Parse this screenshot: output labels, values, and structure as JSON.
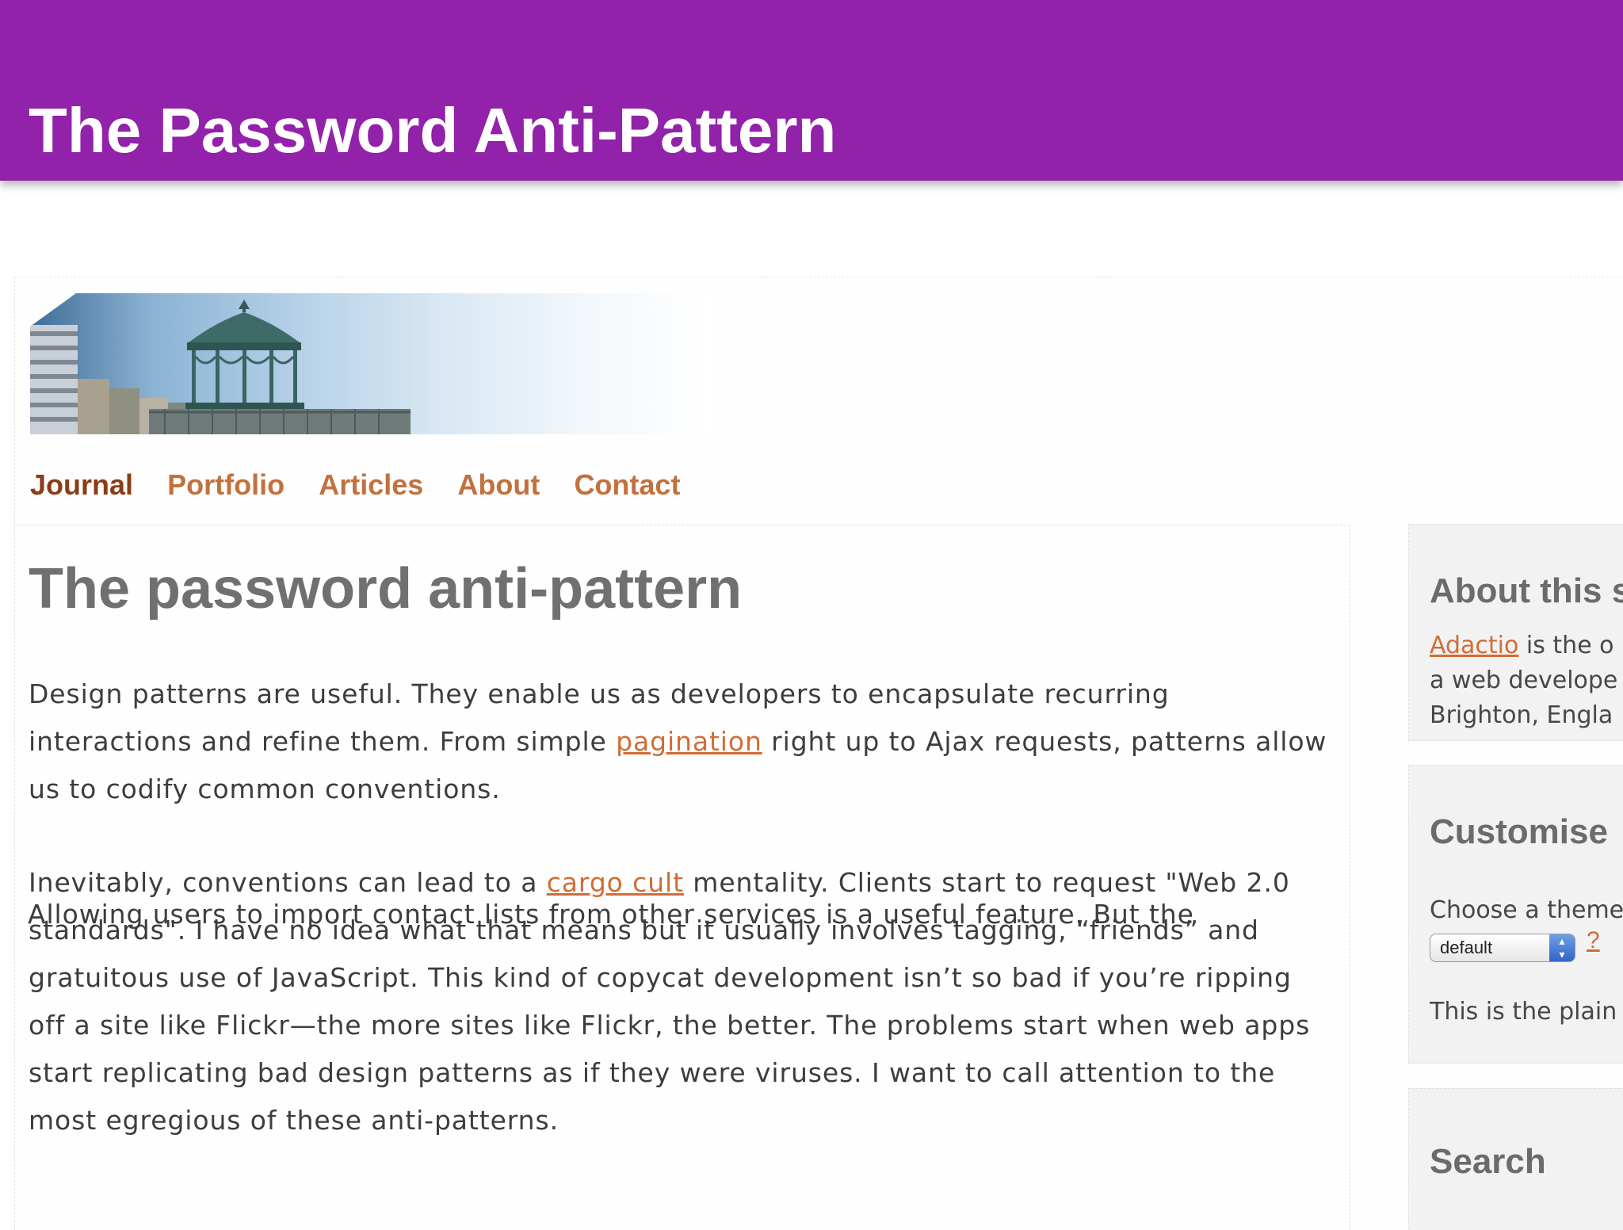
{
  "slide": {
    "title": "The Password Anti-Pattern"
  },
  "nav": [
    "Journal",
    "Portfolio",
    "Articles",
    "About",
    "Contact"
  ],
  "article": {
    "title": "The password anti-pattern",
    "p1": {
      "before": "Design patterns are useful. They enable us as developers to encapsulate recurring interactions and refine them. From simple ",
      "link": "pagination",
      "after": " right up to Ajax requests, patterns allow us to codify common conventions."
    },
    "p2": {
      "before": "Inevitably, conventions can lead to a ",
      "link": "cargo cult",
      "after": " mentality. Clients start to request \"Web 2.0 standards\". I have no idea what that means but it usually involves tagging, “friends” and gratuitous use of JavaScript. This kind of copycat development isn’t so bad if you’re ripping off a site like Flickr—the more sites like Flickr, the better. The problems start when web apps start replicating bad design patterns as if they were viruses. I want to call attention to the most egregious of these anti-patterns."
    },
    "p3": "Allowing users to import contact lists from other services is a useful feature. But the"
  },
  "sidebar": {
    "about": {
      "heading": "About this s",
      "link": "Adactio",
      "line1_rest": " is the o",
      "line2": "a web develope",
      "line3": "Brighton, Engla"
    },
    "customise": {
      "heading": "Customise",
      "label": "Choose a theme",
      "select_value": "default",
      "help": "?",
      "note": "This is the plain"
    },
    "search": {
      "heading": "Search"
    }
  },
  "colors": {
    "header_bg": "#9122a9",
    "nav_link": "#c2713e",
    "nav_current": "#8a3d17",
    "link": "#d16d36"
  }
}
